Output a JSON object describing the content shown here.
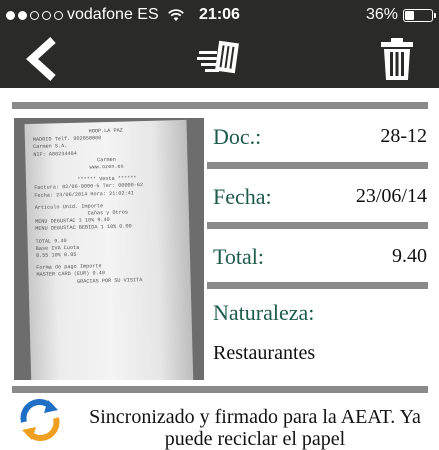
{
  "status_bar": {
    "carrier": "vodafone ES",
    "time": "21:06",
    "battery_percent": "36%",
    "battery_level": 0.36,
    "signal_bars_filled": 2,
    "signal_bars_total": 5
  },
  "nav": {
    "back_icon": "chevron-left-icon",
    "scan_icon": "scan-document-icon",
    "trash_icon": "trash-icon"
  },
  "receipt_image": {
    "lines": [
      "HOOP.LA PAZ",
      "MADRID          Telf. 902850000",
      "Carmen S.A.",
      "NIF: A80234484",
      "Carmen",
      "www.ozen.es",
      "******  Venta  ******",
      "Factura: 02/06-0000-5 Ter: 00000-62",
      "Fecha: 23/06/2014     Hora: 21:02:41",
      "Articulo      Unid.       Importe",
      "Cañas y Otros",
      "MENU DEGUSTAC   1    10%     9.40",
      "MENU DEGUSTAC BEBIDA  1 10%  0.00",
      "TOTAL                        9.40",
      "Base     IVA     Cuota",
      "8.55     10%     0.85",
      "Forma de pago          Importe",
      "MASTER CARD (EUR)         9.40",
      "GRACIAS POR SU VISITA"
    ]
  },
  "fields": {
    "doc_label": "Doc.:",
    "doc_value": "28-12",
    "fecha_label": "Fecha:",
    "fecha_value": "23/06/14",
    "total_label": "Total:",
    "total_value": "9.40",
    "naturaleza_label": "Naturaleza:",
    "naturaleza_value": "Restaurantes"
  },
  "sync": {
    "icon": "sync-arrows-icon",
    "message": "Sincronizado y firmado para la AEAT. Ya puede reciclar el papel"
  },
  "colors": {
    "bar_background": "#2a2b28",
    "label_green": "#1d5b4a",
    "divider_gray": "#8a8a8a",
    "sync_blue": "#1f6fc4",
    "sync_orange": "#f0a020"
  }
}
